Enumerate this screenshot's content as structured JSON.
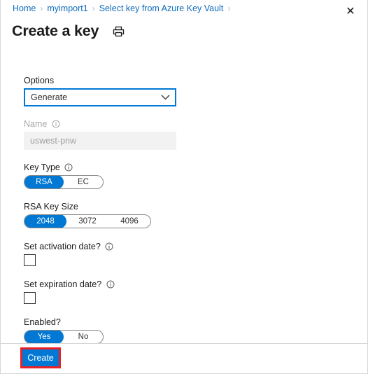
{
  "breadcrumb": {
    "items": [
      "Home",
      "myimport1",
      "Select key from Azure Key Vault"
    ],
    "separator": "›",
    "trailing_separator": "›"
  },
  "header": {
    "title": "Create a key",
    "print_icon": "printer-icon",
    "close_icon": "✕"
  },
  "form": {
    "options": {
      "label": "Options",
      "value": "Generate",
      "chevron": "chevron-down-icon"
    },
    "name": {
      "label": "Name",
      "value": "uswest-pnw",
      "info": "ⓘ",
      "disabled": true
    },
    "key_type": {
      "label": "Key Type",
      "info": "ⓘ",
      "options": [
        "RSA",
        "EC"
      ],
      "selected": "RSA"
    },
    "rsa_key_size": {
      "label": "RSA Key Size",
      "options": [
        "2048",
        "3072",
        "4096"
      ],
      "selected": "2048"
    },
    "activation_date": {
      "label": "Set activation date?",
      "info": "ⓘ",
      "checked": false
    },
    "expiration_date": {
      "label": "Set expiration date?",
      "info": "ⓘ",
      "checked": false
    },
    "enabled": {
      "label": "Enabled?",
      "options": [
        "Yes",
        "No"
      ],
      "selected": "Yes"
    }
  },
  "footer": {
    "create_label": "Create"
  },
  "colors": {
    "accent": "#0078d4",
    "link": "#0f6cbd",
    "highlight": "#ec2024",
    "disabled_bg": "#f2f2f2",
    "disabled_text": "#a1a1a1",
    "border": "#d6d6d6"
  }
}
